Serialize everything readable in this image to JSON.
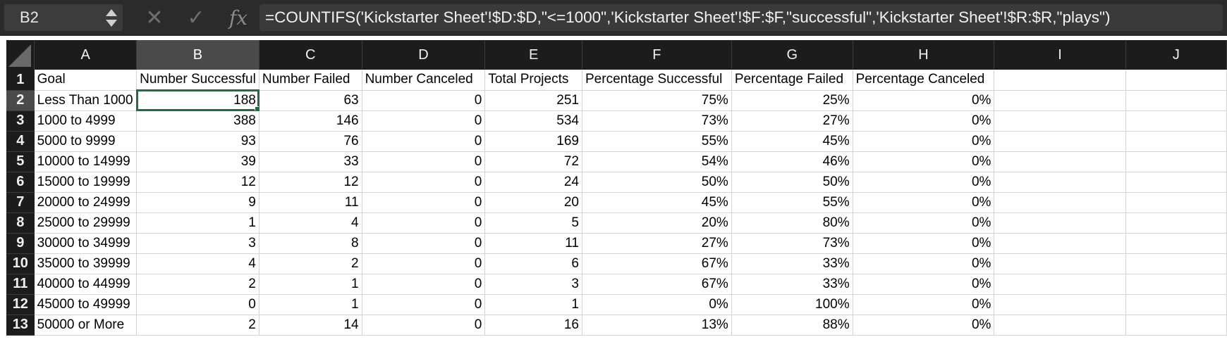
{
  "formula_bar": {
    "cell_reference": "B2",
    "cancel_glyph": "✕",
    "confirm_glyph": "✓",
    "fx_label": "fx",
    "formula": "=COUNTIFS('Kickstarter Sheet'!$D:$D,\"<=1000\",'Kickstarter Sheet'!$F:$F,\"successful\",'Kickstarter Sheet'!$R:$R,\"plays\")"
  },
  "sheet": {
    "selected_cell": "B2",
    "column_headers": [
      "A",
      "B",
      "C",
      "D",
      "E",
      "F",
      "G",
      "H",
      "I",
      "J"
    ],
    "row_headers": [
      "1",
      "2",
      "3",
      "4",
      "5",
      "6",
      "7",
      "8",
      "9",
      "10",
      "11",
      "12",
      "13"
    ],
    "rows": [
      [
        "Goal",
        "Number Successful",
        "Number Failed",
        "Number Canceled",
        "Total Projects",
        "Percentage Successful",
        "Percentage Failed",
        "Percentage Canceled",
        "",
        ""
      ],
      [
        "Less Than 1000",
        "188",
        "63",
        "0",
        "251",
        "75%",
        "25%",
        "0%",
        "",
        ""
      ],
      [
        "1000 to 4999",
        "388",
        "146",
        "0",
        "534",
        "73%",
        "27%",
        "0%",
        "",
        ""
      ],
      [
        "5000 to 9999",
        "93",
        "76",
        "0",
        "169",
        "55%",
        "45%",
        "0%",
        "",
        ""
      ],
      [
        "10000 to 14999",
        "39",
        "33",
        "0",
        "72",
        "54%",
        "46%",
        "0%",
        "",
        ""
      ],
      [
        "15000 to 19999",
        "12",
        "12",
        "0",
        "24",
        "50%",
        "50%",
        "0%",
        "",
        ""
      ],
      [
        "20000 to 24999",
        "9",
        "11",
        "0",
        "20",
        "45%",
        "55%",
        "0%",
        "",
        ""
      ],
      [
        "25000 to 29999",
        "1",
        "4",
        "0",
        "5",
        "20%",
        "80%",
        "0%",
        "",
        ""
      ],
      [
        "30000 to 34999",
        "3",
        "8",
        "0",
        "11",
        "27%",
        "73%",
        "0%",
        "",
        ""
      ],
      [
        "35000 to 39999",
        "4",
        "2",
        "0",
        "6",
        "67%",
        "33%",
        "0%",
        "",
        ""
      ],
      [
        "40000 to 44999",
        "2",
        "1",
        "0",
        "3",
        "67%",
        "33%",
        "0%",
        "",
        ""
      ],
      [
        "45000 to 49999",
        "0",
        "1",
        "0",
        "1",
        "0%",
        "100%",
        "0%",
        "",
        ""
      ],
      [
        "50000 or More",
        "2",
        "14",
        "0",
        "16",
        "13%",
        "88%",
        "0%",
        "",
        ""
      ]
    ]
  },
  "colors": {
    "toolbar_bg": "#2b2b2b",
    "header_bg": "#1c1c1c",
    "header_selected_bg": "#4a4a4a",
    "selection_accent": "#1f6e43",
    "gridline": "#d4d4d4"
  },
  "icons": {
    "stepper": "name-box-stepper-icon",
    "cancel": "cancel-icon",
    "confirm": "confirm-icon",
    "function": "fx-icon",
    "select_all": "select-all-icon"
  }
}
